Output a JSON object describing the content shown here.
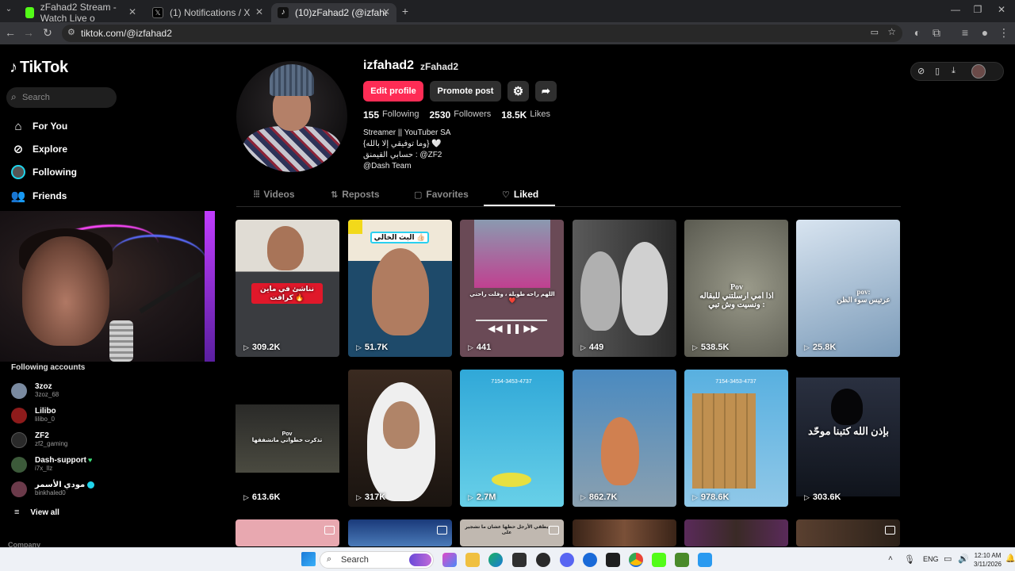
{
  "browser": {
    "tabs": [
      {
        "title": "zFahad2 Stream - Watch Live o",
        "favicon_color": "#53fc18"
      },
      {
        "title": "(1) Notifications / X",
        "favicon_color": "#000000"
      },
      {
        "title": "(10)zFahad2 (@izfahad2) | TikTo",
        "favicon_color": "#111111"
      }
    ],
    "new_tab": "+",
    "url": "tiktok.com/@izfahad2",
    "window_controls": [
      "—",
      "❐",
      "✕"
    ]
  },
  "nav": {
    "logo_text": "TikTok",
    "search_placeholder": "Search",
    "items": [
      {
        "label": "For You",
        "icon": "home-icon"
      },
      {
        "label": "Explore",
        "icon": "compass-icon"
      },
      {
        "label": "Following",
        "icon": "following-avatar-icon"
      },
      {
        "label": "Friends",
        "icon": "friends-icon"
      }
    ],
    "following_title": "Following accounts",
    "accounts": [
      {
        "name": "3zoz",
        "handle": "3zoz_68",
        "avatar_color": "#7a8aa0",
        "verified": false,
        "heart": false
      },
      {
        "name": "Lilibo",
        "handle": "lilibo_0",
        "avatar_color": "#8e1b1b",
        "verified": false,
        "heart": false
      },
      {
        "name": "ZF2",
        "handle": "zf2_gaming",
        "avatar_color": "#2a2a2a",
        "verified": false,
        "heart": false
      },
      {
        "name": "Dash-support",
        "handle": "i7x_llz",
        "avatar_color": "#3c5a3a",
        "verified": false,
        "heart": true
      },
      {
        "name": "مودي الأسمر",
        "handle": "binkhaled0",
        "avatar_color": "#6b3a4a",
        "verified": true,
        "heart": false
      }
    ],
    "view_all": "View all",
    "company": "Company"
  },
  "profile": {
    "username": "izfahad2",
    "display_name": "zFahad2",
    "edit_label": "Edit profile",
    "promote_label": "Promote post",
    "stats": [
      {
        "value": "155",
        "label": "Following"
      },
      {
        "value": "2530",
        "label": "Followers"
      },
      {
        "value": "18.5K",
        "label": "Likes"
      }
    ],
    "bio": [
      "Streamer || YouTuber SA",
      "{وما توفيقي إلا بالله} 🤍",
      "حسابي القيمنق : @ZF2",
      "@Dash Team"
    ]
  },
  "tabs": [
    {
      "label": "Videos",
      "icon": "grid-icon",
      "selected": false
    },
    {
      "label": "Reposts",
      "icon": "repost-icon",
      "selected": false
    },
    {
      "label": "Favorites",
      "icon": "bookmark-icon",
      "selected": false
    },
    {
      "label": "Liked",
      "icon": "heart-icon",
      "selected": true
    }
  ],
  "videos": [
    {
      "views": "309.2K",
      "caption": "نناشئ في ماين كرافت 🔥",
      "bg": "#3a3c40"
    },
    {
      "views": "51.7K",
      "caption": "البث الخالي 👍🏻",
      "bg": "#1e4a6a"
    },
    {
      "views": "441",
      "caption": "اللهم راحه طويلة ، وقلت راحتي ❤️",
      "bg": "#6a4a56"
    },
    {
      "views": "449",
      "caption": "",
      "bg": "#404040"
    },
    {
      "views": "538.5K",
      "caption": "Pov\nاذا امي ارسلتني للبقاله ونسيت وش تبي :",
      "bg": "#7a7a6a"
    },
    {
      "views": "25.8K",
      "caption": "pov:\nعرتيس سوء الظن",
      "bg": "#9fb8d4"
    },
    {
      "views": "613.6K",
      "caption": "Pov\nتذكرت خطواتي ماتشفقها",
      "bg": "#1a1a1a"
    },
    {
      "views": "317K",
      "caption": "",
      "bg": "#3a2a20"
    },
    {
      "views": "2.7M",
      "caption": "",
      "bg": "#4ab8d8"
    },
    {
      "views": "862.7K",
      "caption": "",
      "bg": "#4a90c0"
    },
    {
      "views": "978.6K",
      "caption": "",
      "bg": "#6ab8e0"
    },
    {
      "views": "303.6K",
      "caption": "بإذن الله كتبنا موحّد",
      "bg": "#1a1e2c"
    },
    {
      "views": "",
      "caption": "",
      "bg": "#e8a8b0"
    },
    {
      "views": "",
      "caption": "",
      "bg": "#2a5a9a"
    },
    {
      "views": "",
      "caption": "يطقي الأرجل حظها عشان ما تشجير على",
      "bg": "#c0b8b0"
    },
    {
      "views": "",
      "caption": "",
      "bg": "#5a3a2a"
    },
    {
      "views": "",
      "caption": "",
      "bg": "#4a3050"
    },
    {
      "views": "",
      "caption": "",
      "bg": "#4a3a30"
    }
  ],
  "taskbar": {
    "search_label": "Search",
    "lang": "ENG",
    "time": "12:10 AM",
    "date": "3/11/2026"
  },
  "colors": {
    "accent": "#fe2c55",
    "following_icon_ring": "#20d5ec"
  }
}
